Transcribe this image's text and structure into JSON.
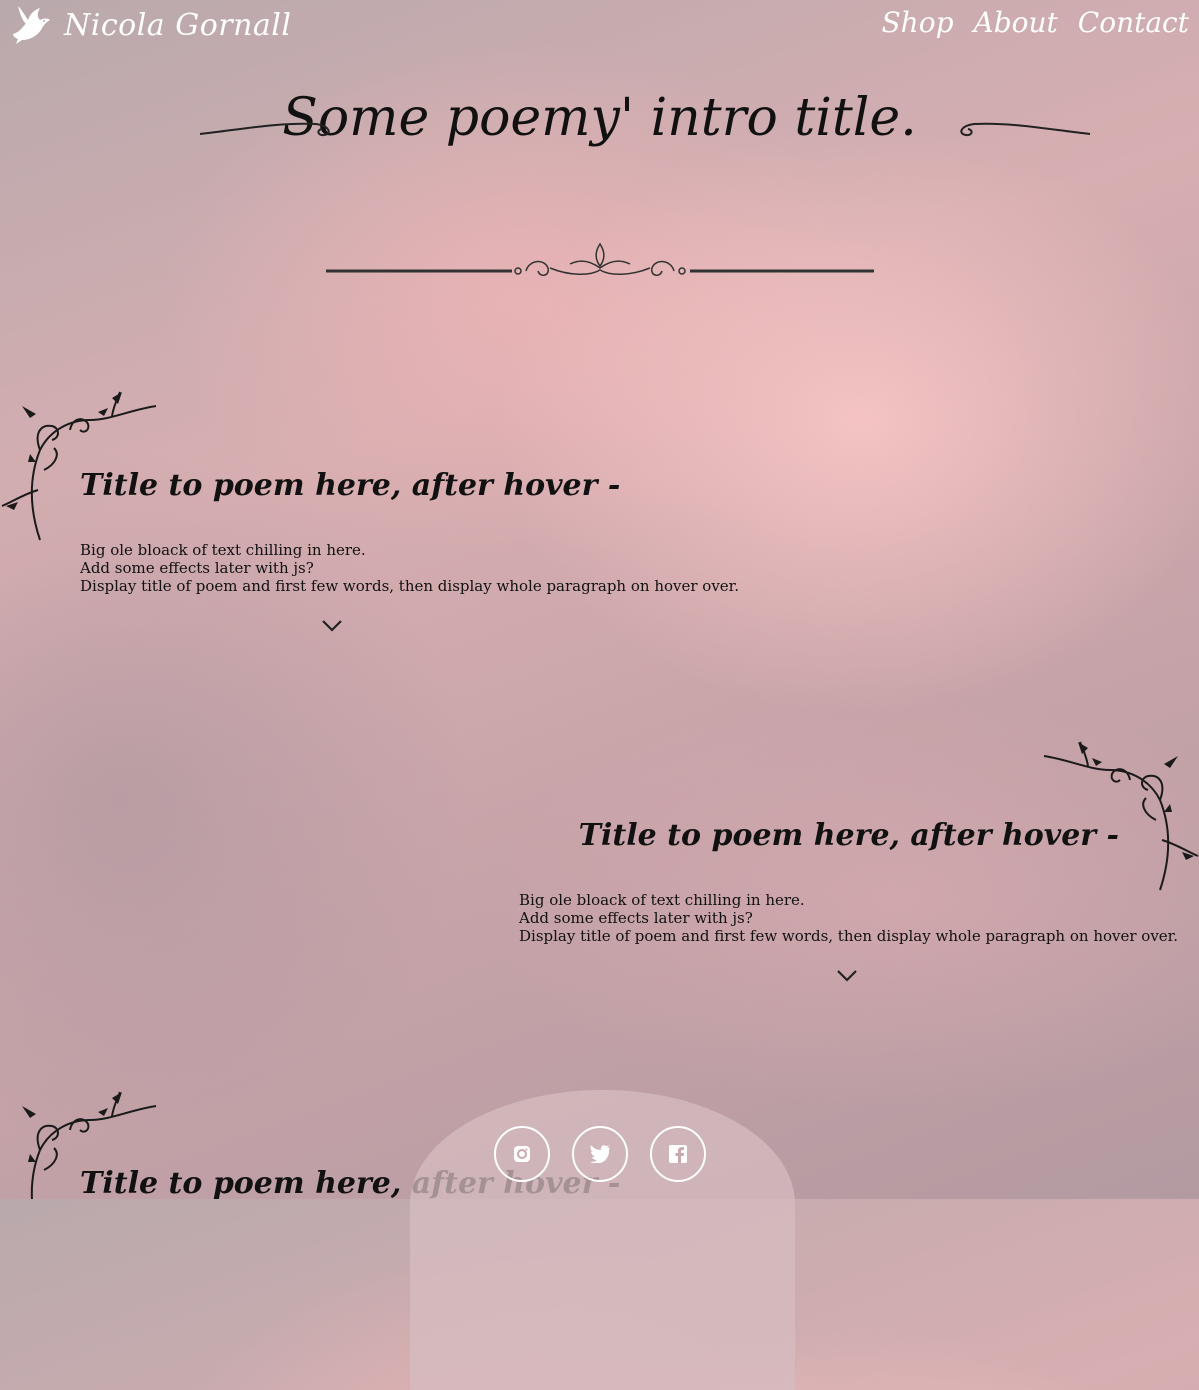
{
  "brand": {
    "name": "Nicola Gornall",
    "logo_icon": "dove-icon"
  },
  "nav": {
    "items": [
      {
        "label": "Shop"
      },
      {
        "label": "About"
      },
      {
        "label": "Contact"
      }
    ]
  },
  "intro": {
    "title": "Some poemy' intro title."
  },
  "poems": [
    {
      "title": "Title to poem here, after hover -",
      "lines": [
        "Big ole bloack of text chilling in here.",
        "Add some effects later with js?",
        "Display title of poem and first few words, then display whole paragraph on hover over."
      ]
    },
    {
      "title": "Title to poem here, after hover -",
      "lines": [
        "Big ole bloack of text chilling in here.",
        "Add some effects later with js?",
        "Display title of poem and first few words, then display whole paragraph on hover over."
      ]
    },
    {
      "title": "Title to poem here, after hover -",
      "lines": []
    }
  ],
  "social": [
    {
      "icon": "instagram-icon"
    },
    {
      "icon": "twitter-icon"
    },
    {
      "icon": "facebook-icon"
    }
  ],
  "colors": {
    "text": "#111111",
    "header_text": "#ffffff"
  }
}
